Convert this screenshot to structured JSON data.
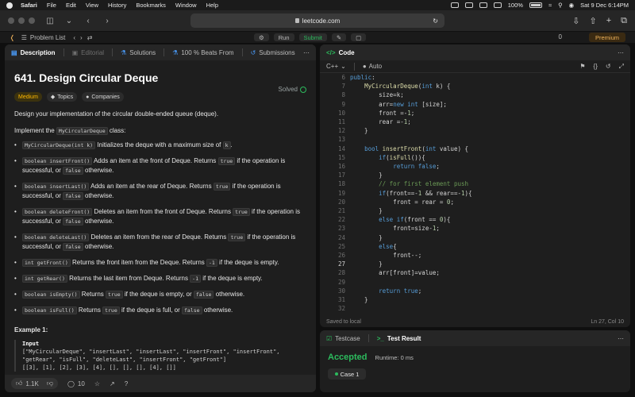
{
  "menubar": {
    "app": "Safari",
    "items": [
      "File",
      "Edit",
      "View",
      "History",
      "Bookmarks",
      "Window",
      "Help"
    ],
    "battery": "100%",
    "datetime": "Sat 9 Dec  6:14PM"
  },
  "safari": {
    "url": "leetcode.com"
  },
  "lc_toolbar": {
    "problem_list": "Problem List",
    "run": "Run",
    "submit": "Submit",
    "premium": "Premium",
    "counter": "0"
  },
  "left_tabs": {
    "description": "Description",
    "editorial": "Editorial",
    "solutions": "Solutions",
    "beats": "100 % Beats From",
    "submissions": "Submissions"
  },
  "problem": {
    "title": "641. Design Circular Deque",
    "solved": "Solved",
    "chips": {
      "difficulty": "Medium",
      "topics": "Topics",
      "companies": "Companies"
    },
    "intro": "Design your implementation of the circular double-ended queue (deque).",
    "implement_prefix": "Implement the ",
    "implement_code": "MyCircularDeque",
    "implement_suffix": " class:",
    "methods": [
      {
        "code": "MyCircularDeque(int k)",
        "text": " Initializes the deque with a maximum size of ",
        "code2": "k",
        "text2": "."
      },
      {
        "code": "boolean insertFront()",
        "text": " Adds an item at the front of Deque. Returns ",
        "code2": "true",
        "text2": " if the operation is successful, or ",
        "code3": "false",
        "text3": " otherwise."
      },
      {
        "code": "boolean insertLast()",
        "text": " Adds an item at the rear of Deque. Returns ",
        "code2": "true",
        "text2": " if the operation is successful, or ",
        "code3": "false",
        "text3": " otherwise."
      },
      {
        "code": "boolean deleteFront()",
        "text": " Deletes an item from the front of Deque. Returns ",
        "code2": "true",
        "text2": " if the operation is successful, or ",
        "code3": "false",
        "text3": " otherwise."
      },
      {
        "code": "boolean deleteLast()",
        "text": " Deletes an item from the rear of Deque. Returns ",
        "code2": "true",
        "text2": " if the operation is successful, or ",
        "code3": "false",
        "text3": " otherwise."
      },
      {
        "code": "int getFront()",
        "text": " Returns the front item from the Deque. Returns ",
        "code2": "-1",
        "text2": " if the deque is empty."
      },
      {
        "code": "int getRear()",
        "text": " Returns the last item from Deque. Returns ",
        "code2": "-1",
        "text2": " if the deque is empty."
      },
      {
        "code": "boolean isEmpty()",
        "text": " Returns ",
        "code2": "true",
        "text2": " if the deque is empty, or ",
        "code3": "false",
        "text3": " otherwise."
      },
      {
        "code": "boolean isFull()",
        "text": " Returns ",
        "code2": "true",
        "text2": " if the deque is full, or ",
        "code3": "false",
        "text3": " otherwise."
      }
    ],
    "example_title": "Example 1:",
    "example_input_label": "Input",
    "example_lines": [
      "[\"MyCircularDeque\", \"insertLast\", \"insertLast\", \"insertFront\", \"insertFront\",",
      "\"getRear\", \"isFull\", \"deleteLast\", \"insertFront\", \"getFront\"]",
      "[[3], [1], [2], [3], [4], [], [], [], [4], []]"
    ]
  },
  "left_footer": {
    "likes": "1.1K",
    "comments": "10"
  },
  "code_panel": {
    "title": "Code",
    "language": "C++",
    "auto": "Auto",
    "saved": "Saved to local",
    "cursor": "Ln 27, Col 10",
    "lines": [
      {
        "n": "6",
        "html": "<span class='kw'>public</span>:"
      },
      {
        "n": "7",
        "html": "    <span class='fn'>MyCircularDeque</span>(<span class='kw'>int</span> k) {"
      },
      {
        "n": "8",
        "html": "        size=k;"
      },
      {
        "n": "9",
        "html": "        arr=<span class='kw'>new</span> <span class='kw'>int</span> [size];"
      },
      {
        "n": "10",
        "html": "        front =-<span class='num'>1</span>;"
      },
      {
        "n": "11",
        "html": "        rear =-<span class='num'>1</span>;"
      },
      {
        "n": "12",
        "html": "    }"
      },
      {
        "n": "13",
        "html": ""
      },
      {
        "n": "14",
        "html": "    <span class='kw'>bool</span> <span class='fn'>insertFront</span>(<span class='kw'>int</span> value) {"
      },
      {
        "n": "15",
        "html": "        <span class='kw'>if</span>(<span class='fn'>isFull</span>()){"
      },
      {
        "n": "16",
        "html": "            <span class='kw'>return</span> <span class='kw'>false</span>;"
      },
      {
        "n": "17",
        "html": "        }"
      },
      {
        "n": "18",
        "html": "        <span class='cm'>// for first element push</span>"
      },
      {
        "n": "19",
        "html": "        <span class='kw'>if</span>(front==-<span class='num'>1</span> && rear==-<span class='num'>1</span>){"
      },
      {
        "n": "20",
        "html": "            front = rear = <span class='num'>0</span>;"
      },
      {
        "n": "21",
        "html": "        }"
      },
      {
        "n": "22",
        "html": "        <span class='kw'>else</span> <span class='kw'>if</span>(front == <span class='num'>0</span>){"
      },
      {
        "n": "23",
        "html": "            front=size-<span class='num'>1</span>;"
      },
      {
        "n": "24",
        "html": "        }"
      },
      {
        "n": "25",
        "html": "        <span class='kw'>else</span>{"
      },
      {
        "n": "26",
        "html": "            front--;"
      },
      {
        "n": "27",
        "html": "        }"
      },
      {
        "n": "28",
        "html": "        arr[front]=value;"
      },
      {
        "n": "29",
        "html": ""
      },
      {
        "n": "30",
        "html": "        <span class='kw'>return</span> <span class='kw'>true</span>;"
      },
      {
        "n": "31",
        "html": "    }"
      },
      {
        "n": "32",
        "html": ""
      }
    ]
  },
  "result_panel": {
    "testcase_tab": "Testcase",
    "result_tab": "Test Result",
    "status": "Accepted",
    "runtime": "Runtime: 0 ms",
    "case": "Case 1"
  },
  "colors": {
    "accepted": "#2cbb5d",
    "medium": "#ffb800",
    "keyword": "#569cd6",
    "function": "#dcdcaa",
    "comment": "#6a9955",
    "premium": "#f0b35a"
  }
}
